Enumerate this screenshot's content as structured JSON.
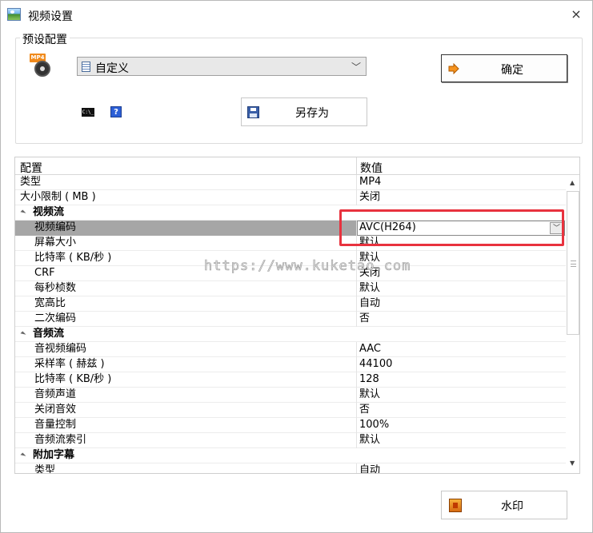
{
  "window": {
    "title": "视频设置",
    "close_glyph": "×"
  },
  "preset": {
    "group_label": "预设配置",
    "icon": "mp4-file-icon",
    "icon_badge": "MP4",
    "select_value": "自定义",
    "ok_label": "确定",
    "save_as_label": "另存为",
    "cmd_icon_text": "C:\\_",
    "help_icon_text": "?"
  },
  "grid": {
    "col_name": "配置",
    "col_value": "数值",
    "rows": [
      {
        "kind": "prop",
        "indent": false,
        "name": "类型",
        "value": "MP4"
      },
      {
        "kind": "prop",
        "indent": false,
        "name": "大小限制 ( MB )",
        "value": "关闭"
      },
      {
        "kind": "cat",
        "name": "视频流",
        "value": ""
      },
      {
        "kind": "prop",
        "indent": true,
        "name": "视频编码",
        "value": "AVC(H264)",
        "selected": true,
        "editing": true
      },
      {
        "kind": "prop",
        "indent": true,
        "name": "屏幕大小",
        "value": "默认"
      },
      {
        "kind": "prop",
        "indent": true,
        "name": "比特率 ( KB/秒 )",
        "value": "默认"
      },
      {
        "kind": "prop",
        "indent": true,
        "name": "CRF",
        "value": "关闭"
      },
      {
        "kind": "prop",
        "indent": true,
        "name": "每秒桢数",
        "value": "默认"
      },
      {
        "kind": "prop",
        "indent": true,
        "name": "宽高比",
        "value": "自动"
      },
      {
        "kind": "prop",
        "indent": true,
        "name": "二次编码",
        "value": "否"
      },
      {
        "kind": "cat",
        "name": "音频流",
        "value": ""
      },
      {
        "kind": "prop",
        "indent": true,
        "name": "音视频编码",
        "value": "AAC"
      },
      {
        "kind": "prop",
        "indent": true,
        "name": "采样率 ( 赫兹 )",
        "value": "44100"
      },
      {
        "kind": "prop",
        "indent": true,
        "name": "比特率 ( KB/秒 )",
        "value": "128"
      },
      {
        "kind": "prop",
        "indent": true,
        "name": "音频声道",
        "value": "默认"
      },
      {
        "kind": "prop",
        "indent": true,
        "name": "关闭音效",
        "value": "否"
      },
      {
        "kind": "prop",
        "indent": true,
        "name": "音量控制",
        "value": "100%"
      },
      {
        "kind": "prop",
        "indent": true,
        "name": "音频流索引",
        "value": "默认"
      },
      {
        "kind": "cat",
        "name": "附加字幕",
        "value": ""
      },
      {
        "kind": "prop",
        "indent": true,
        "name": "类型",
        "value": "自动"
      }
    ]
  },
  "watermark_text": "https://www.kuketao.com",
  "watermark_button_label": "水印",
  "colors": {
    "highlight": "#e8323e",
    "selected_row": "#a6a6a6"
  }
}
